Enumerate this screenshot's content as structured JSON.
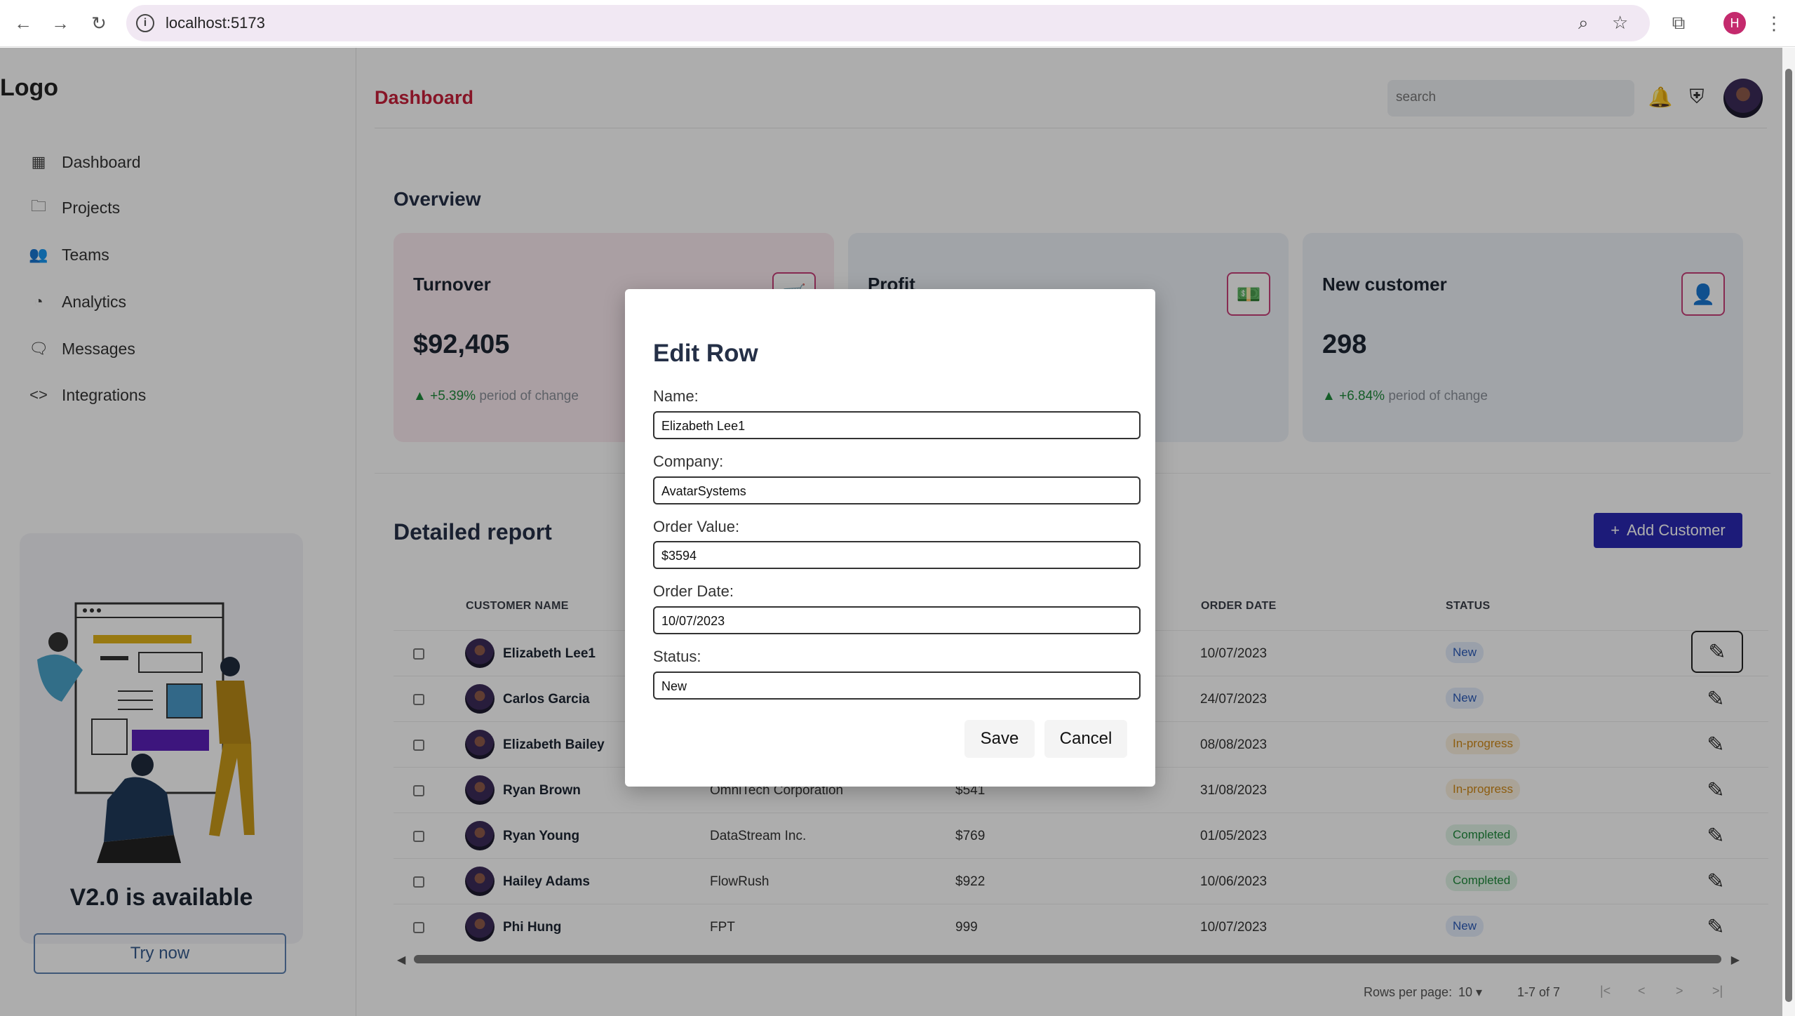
{
  "browser": {
    "url": "localhost:5173",
    "profile_initial": "H",
    "back_icon": "arrow-left-icon",
    "forward_icon": "arrow-right-icon",
    "reload_icon": "reload-icon"
  },
  "sidebar": {
    "logo": "Logo",
    "items": [
      {
        "label": "Dashboard",
        "icon": "grid-icon"
      },
      {
        "label": "Projects",
        "icon": "folder-icon"
      },
      {
        "label": "Teams",
        "icon": "users-icon"
      },
      {
        "label": "Analytics",
        "icon": "pie-chart-icon"
      },
      {
        "label": "Messages",
        "icon": "message-icon"
      },
      {
        "label": "Integrations",
        "icon": "code-icon"
      }
    ],
    "promo": {
      "title": "V2.0 is available",
      "button": "Try now"
    }
  },
  "header": {
    "title": "Dashboard",
    "search_placeholder": "search"
  },
  "overview": {
    "title": "Overview",
    "cards": [
      {
        "title": "Turnover",
        "value": "$92,405",
        "change": "+5.39%",
        "change_text": "period of change",
        "icon": "cart-icon"
      },
      {
        "title": "Profit",
        "value": "",
        "change": "",
        "change_text": "",
        "icon": "money-icon"
      },
      {
        "title": "New customer",
        "value": "298",
        "change": "+6.84%",
        "change_text": "period of change",
        "icon": "person-icon"
      }
    ]
  },
  "report": {
    "title": "Detailed report",
    "add_button": "Add Customer",
    "columns": {
      "name": "CUSTOMER NAME",
      "date": "ORDER DATE",
      "status": "STATUS"
    },
    "rows": [
      {
        "name": "Elizabeth Lee1",
        "company": "",
        "value": "",
        "date": "10/07/2023",
        "status": "New",
        "status_type": "new"
      },
      {
        "name": "Carlos Garcia",
        "company": "",
        "value": "",
        "date": "24/07/2023",
        "status": "New",
        "status_type": "new"
      },
      {
        "name": "Elizabeth Bailey",
        "company": "",
        "value": "",
        "date": "08/08/2023",
        "status": "In-progress",
        "status_type": "prog"
      },
      {
        "name": "Ryan Brown",
        "company": "OmniTech Corporation",
        "value": "$541",
        "date": "31/08/2023",
        "status": "In-progress",
        "status_type": "prog"
      },
      {
        "name": "Ryan Young",
        "company": "DataStream Inc.",
        "value": "$769",
        "date": "01/05/2023",
        "status": "Completed",
        "status_type": "done"
      },
      {
        "name": "Hailey Adams",
        "company": "FlowRush",
        "value": "$922",
        "date": "10/06/2023",
        "status": "Completed",
        "status_type": "done"
      },
      {
        "name": "Phi Hung",
        "company": "FPT",
        "value": "999",
        "date": "10/07/2023",
        "status": "New",
        "status_type": "new"
      }
    ],
    "pagination": {
      "rows_per_page_label": "Rows per page:",
      "rows_per_page": "10",
      "range": "1-7 of 7"
    }
  },
  "modal": {
    "title": "Edit Row",
    "fields": [
      {
        "label": "Name:",
        "value": "Elizabeth Lee1"
      },
      {
        "label": "Company:",
        "value": "AvatarSystems"
      },
      {
        "label": "Order Value:",
        "value": "$3594"
      },
      {
        "label": "Order Date:",
        "value": "10/07/2023"
      },
      {
        "label": "Status:",
        "value": "New"
      }
    ],
    "save": "Save",
    "cancel": "Cancel"
  },
  "colors": {
    "accent": "#c8203a",
    "primary_button": "#2a29b3",
    "brand_pink": "#c8407a"
  }
}
